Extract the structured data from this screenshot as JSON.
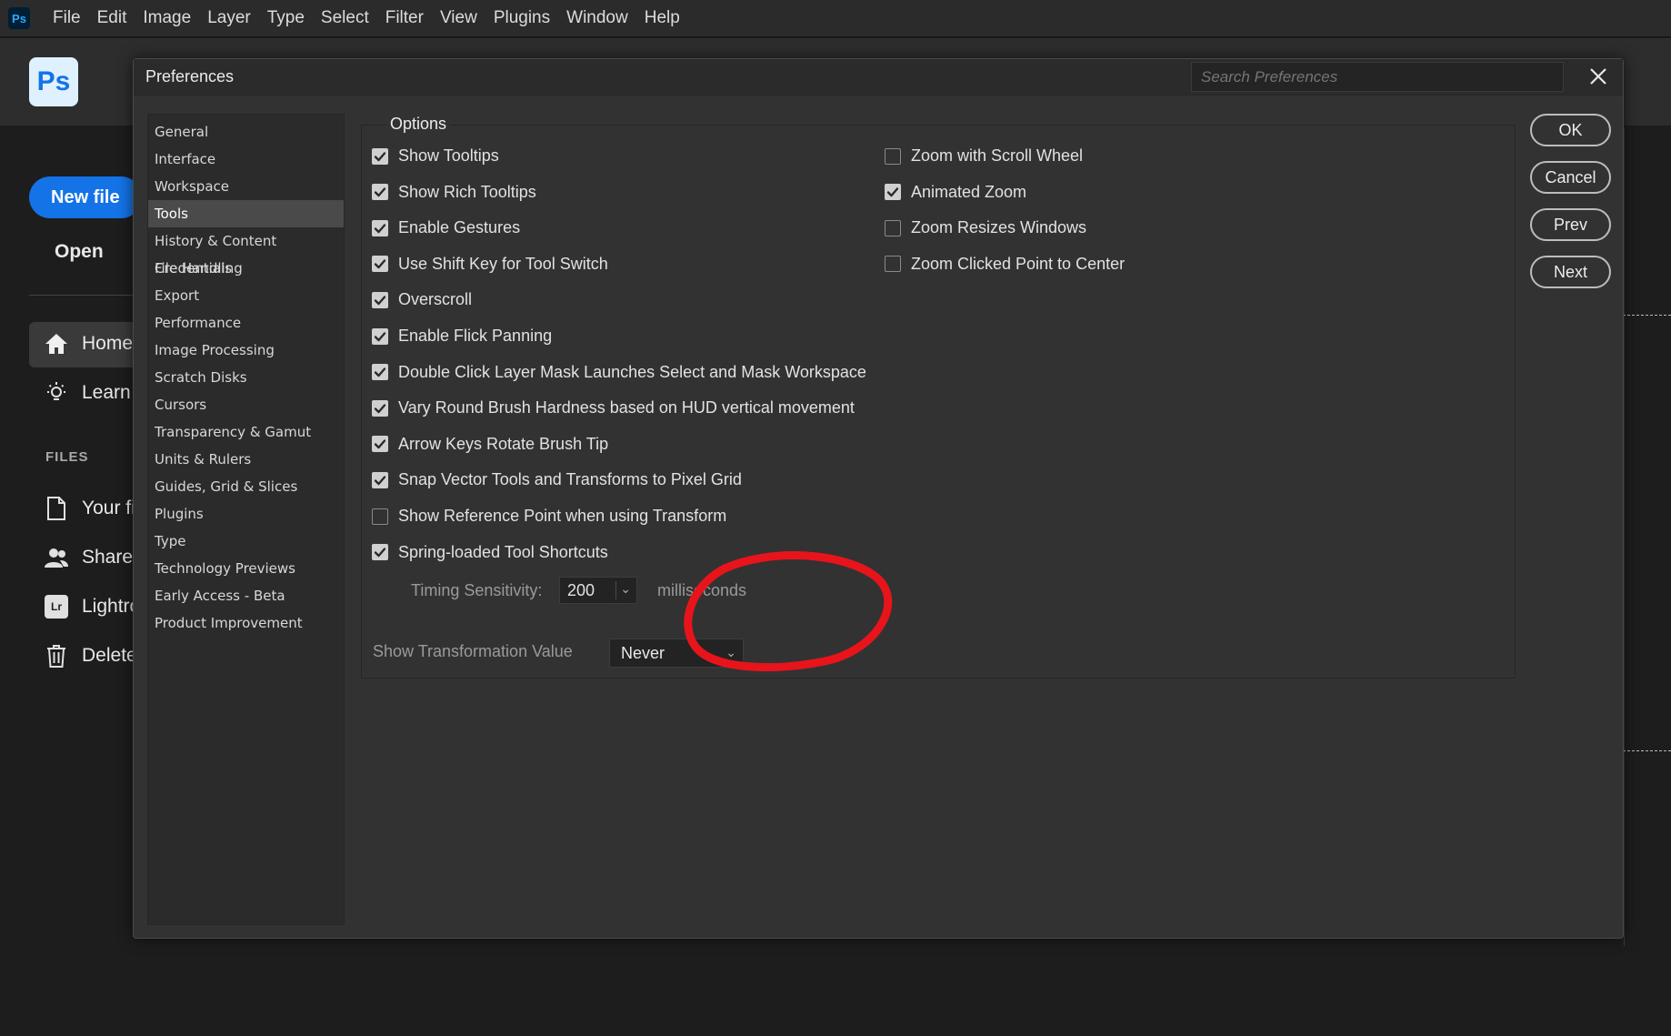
{
  "menubar": {
    "app_badge": "Ps",
    "items": [
      "File",
      "Edit",
      "Image",
      "Layer",
      "Type",
      "Select",
      "Filter",
      "View",
      "Plugins",
      "Window",
      "Help"
    ]
  },
  "home": {
    "logo": "Ps",
    "new_file": "New file",
    "open": "Open",
    "nav": [
      {
        "label": "Home",
        "icon": "home-icon"
      },
      {
        "label": "Learn",
        "icon": "lightbulb-icon"
      }
    ],
    "files_heading": "FILES",
    "files": [
      {
        "label": "Your fi",
        "icon": "file-icon"
      },
      {
        "label": "Sharec",
        "icon": "people-icon"
      },
      {
        "label": "Lightro",
        "icon": "lightroom-icon",
        "badge": "Lr"
      },
      {
        "label": "Delete",
        "icon": "trash-icon"
      }
    ]
  },
  "dialog": {
    "title": "Preferences",
    "search_placeholder": "Search Preferences",
    "categories": [
      "General",
      "Interface",
      "Workspace",
      "Tools",
      "History & Content Credentials",
      "File Handling",
      "Export",
      "Performance",
      "Image Processing",
      "Scratch Disks",
      "Cursors",
      "Transparency & Gamut",
      "Units & Rulers",
      "Guides, Grid & Slices",
      "Plugins",
      "Type",
      "Technology Previews",
      "Early Access - Beta",
      "Product Improvement"
    ],
    "selected_category": "Tools",
    "options_title": "Options",
    "left_options": [
      {
        "label": "Show Tooltips",
        "checked": true
      },
      {
        "label": "Show Rich Tooltips",
        "checked": true
      },
      {
        "label": "Enable Gestures",
        "checked": true
      },
      {
        "label": "Use Shift Key for Tool Switch",
        "checked": true
      },
      {
        "label": "Overscroll",
        "checked": true
      },
      {
        "label": "Enable Flick Panning",
        "checked": true
      },
      {
        "label": "Double Click Layer Mask Launches Select and Mask Workspace",
        "checked": true
      },
      {
        "label": "Vary Round Brush Hardness based on HUD vertical movement",
        "checked": true
      },
      {
        "label": "Arrow Keys Rotate Brush Tip",
        "checked": true
      },
      {
        "label": "Snap Vector Tools and Transforms to Pixel Grid",
        "checked": true
      },
      {
        "label": "Show Reference Point when using Transform",
        "checked": false
      },
      {
        "label": "Spring-loaded Tool Shortcuts",
        "checked": true
      }
    ],
    "right_options": [
      {
        "label": "Zoom with Scroll Wheel",
        "checked": false
      },
      {
        "label": "Animated Zoom",
        "checked": true
      },
      {
        "label": "Zoom Resizes Windows",
        "checked": false
      },
      {
        "label": "Zoom Clicked Point to Center",
        "checked": false
      }
    ],
    "timing": {
      "label": "Timing Sensitivity:",
      "value": "200",
      "unit": "milliseconds"
    },
    "transform_values": {
      "label": "Show Transformation Value",
      "selected": "Never"
    },
    "buttons": {
      "ok": "OK",
      "cancel": "Cancel",
      "prev": "Prev",
      "next": "Next"
    }
  },
  "colors": {
    "accent": "#1473e6",
    "annotation": "#e8141b"
  }
}
